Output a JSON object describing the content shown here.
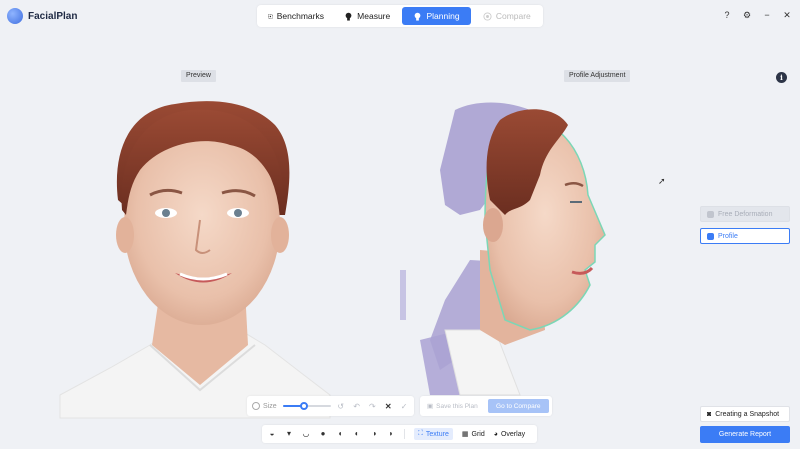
{
  "app": {
    "name": "FacialPlan"
  },
  "tabs": [
    {
      "label": "Benchmarks",
      "icon": "benchmarks-icon"
    },
    {
      "label": "Measure",
      "icon": "measure-icon"
    },
    {
      "label": "Planning",
      "icon": "planning-icon",
      "active": true
    },
    {
      "label": "Compare",
      "icon": "compare-icon",
      "disabled": true
    }
  ],
  "window_controls": {
    "help": "?",
    "settings": "⚙",
    "minimize": "−",
    "close": "✕"
  },
  "panels": {
    "preview_label": "Preview",
    "profile_label": "Profile Adjustment"
  },
  "side": {
    "free_deformation": "Free Deformation",
    "profile": "Profile"
  },
  "toolbar": {
    "size_label": "Size",
    "size_value": 0.45,
    "save_plan": "Save this Plan",
    "go_compare": "Go to Compare"
  },
  "viewbar": {
    "texture": "Texture",
    "grid": "Grid",
    "overlay": "Overlay"
  },
  "actions": {
    "snapshot": "Creating a Snapshot",
    "report": "Generate Report"
  },
  "colors": {
    "accent": "#3b7cf5",
    "background": "#eff1f5"
  }
}
